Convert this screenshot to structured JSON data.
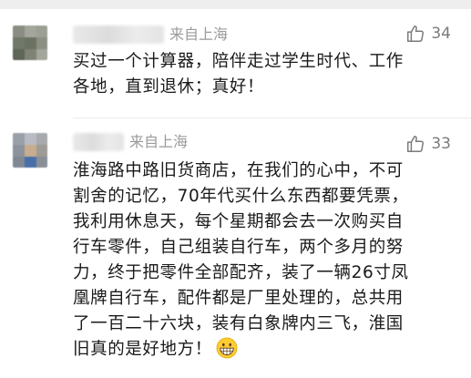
{
  "comments": [
    {
      "location": "来自上海",
      "likes": "34",
      "text_lines": [
        "买过一个计算器，陪伴走过学生时代、工作",
        "各地，直到退休；真好！"
      ]
    },
    {
      "location": "来自上海",
      "likes": "33",
      "text_lines": [
        "淮海路中路旧货商店，在我们的心中，不可",
        "割舍的记忆，70年代买什么东西都要凭票，",
        "我利用休息天，每个星期都会去一次购买自",
        "行车零件，自己组装自行车，两个多月的努",
        "力，终于把零件全部配齐，装了一辆26寸凤",
        "凰牌自行车，配件都是厂里处理的，总共用",
        "了一百二十六块，装有白象牌内三飞，淮国",
        "旧真的是好地方！"
      ],
      "emoji": "grinning-face-emoji"
    }
  ],
  "icons": {
    "like": "thumbs-up-icon"
  },
  "colors": {
    "location": "#9a9a9a",
    "text": "#1a1a1a",
    "like": "#7a7a7a"
  }
}
